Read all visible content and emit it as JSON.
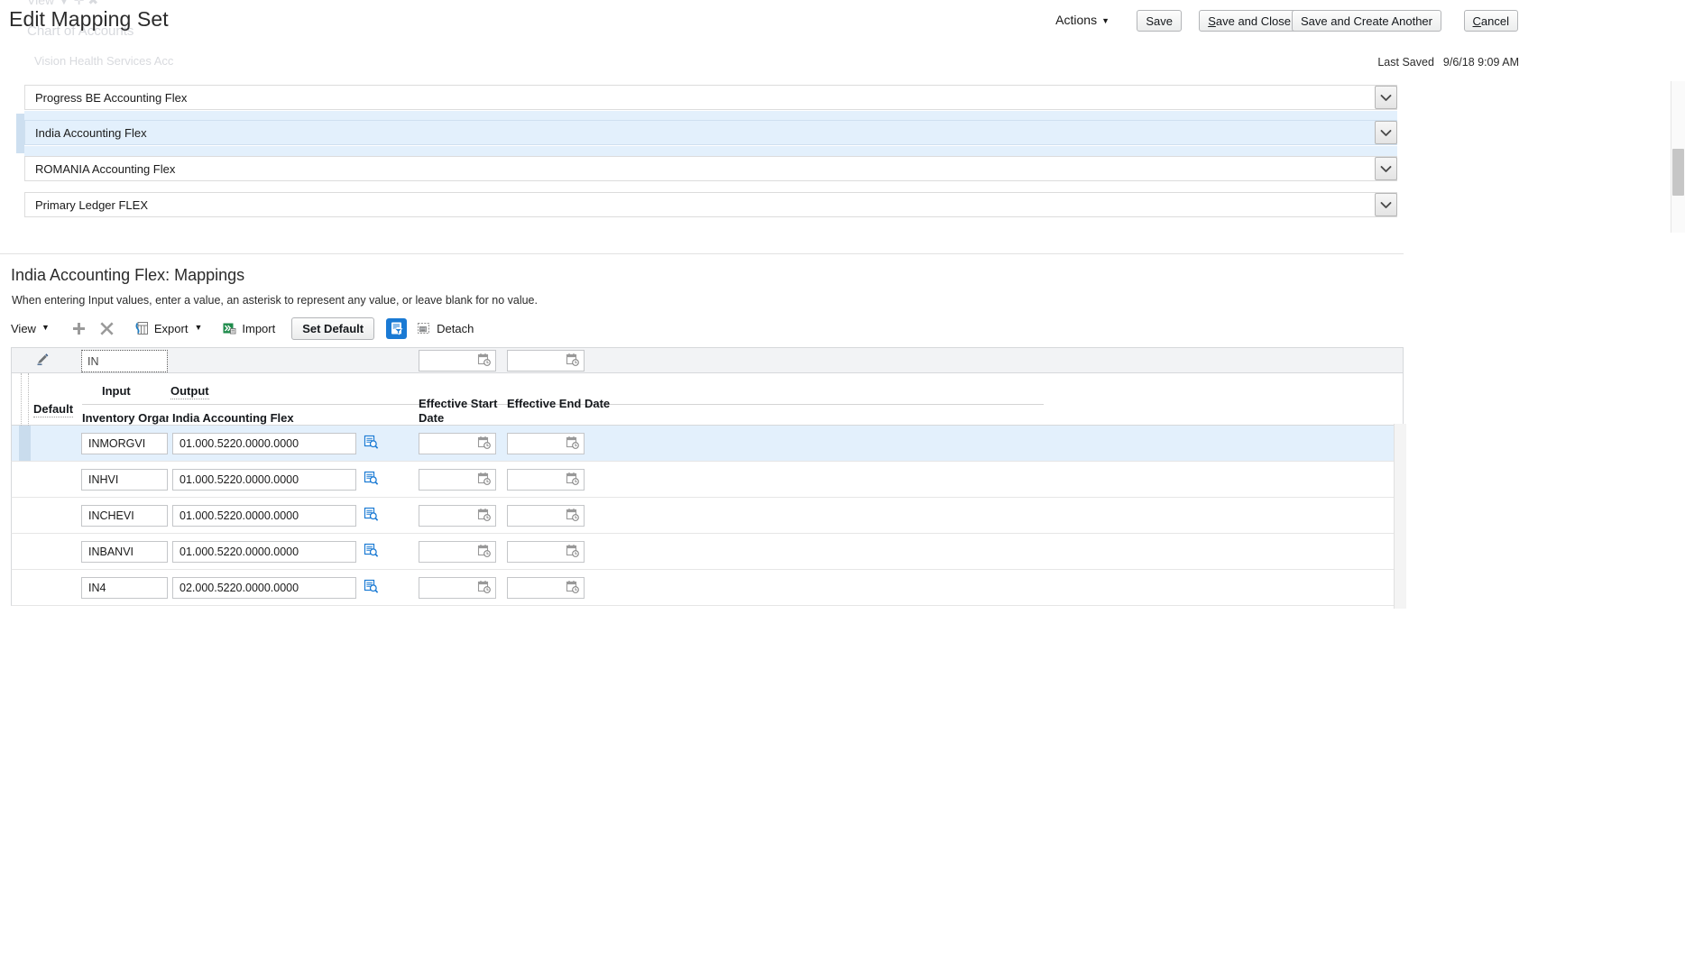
{
  "ghost": {
    "view_label": "View ▼   ✛   ✖",
    "chart_of_accounts": "Chart of Accounts",
    "account_name": "Vision Health Services Acc"
  },
  "header": {
    "page_title": "Edit Mapping Set",
    "actions_label": "Actions",
    "actions_caret": "▼",
    "buttons": {
      "save": "Save",
      "save_and_close_pre": "S",
      "save_and_close_post": "ave and Close",
      "save_and_create_another": "Save and Create Another",
      "cancel_pre": "C",
      "cancel_post": "ancel"
    },
    "last_saved_label": "Last Saved",
    "last_saved_value": "9/6/18 9:09 AM"
  },
  "flex_list": {
    "items": [
      {
        "label": "Progress BE Accounting Flex",
        "selected": false
      },
      {
        "label": "India Accounting Flex",
        "selected": true
      },
      {
        "label": "ROMANIA Accounting Flex",
        "selected": false
      },
      {
        "label": "Primary Ledger FLEX",
        "selected": false
      }
    ],
    "expand_icon": "chevron-down-icon"
  },
  "mappings": {
    "section_title": "India Accounting Flex: Mappings",
    "hint": "When entering Input values, enter a value, an asterisk to represent any value, or leave blank for no value.",
    "toolbar": {
      "view_label": "View",
      "view_caret": "▼",
      "add_icon": "plus-icon",
      "delete_icon": "cross-icon",
      "export_label": "Export",
      "export_caret": "▼",
      "export_icon": "export-icon",
      "import_label": "Import",
      "import_icon": "import-icon",
      "set_default_label": "Set Default",
      "query_by_example_icon": "query-by-example-icon",
      "detach_label": "Detach",
      "detach_icon": "detach-icon"
    },
    "filter_row": {
      "edit_icon": "pencil-icon",
      "input_filter_value": "IN",
      "start_date_filter_value": "",
      "end_date_filter_value": "",
      "calendar_icon": "calendar-icon"
    },
    "columns": {
      "default": "Default",
      "input_group": "Input",
      "output_group": "Output",
      "input_sub": "Inventory Organ",
      "output_sub": "India Accounting Flex",
      "effective_start": "Effective Start Date",
      "effective_end": "Effective End Date"
    },
    "rows": [
      {
        "input": "INMORGVI",
        "output": "01.000.5220.0000.0000",
        "start_date": "",
        "end_date": "",
        "selected": true
      },
      {
        "input": "INHVI",
        "output": "01.000.5220.0000.0000",
        "start_date": "",
        "end_date": "",
        "selected": false
      },
      {
        "input": "INCHEVI",
        "output": "01.000.5220.0000.0000",
        "start_date": "",
        "end_date": "",
        "selected": false
      },
      {
        "input": "INBANVI",
        "output": "01.000.5220.0000.0000",
        "start_date": "",
        "end_date": "",
        "selected": false
      },
      {
        "input": "IN4",
        "output": "02.000.5220.0000.0000",
        "start_date": "",
        "end_date": "",
        "selected": false
      }
    ],
    "row_lov_icon": "search-lov-icon"
  },
  "colors": {
    "accent_blue": "#1a7ad4",
    "selection_blue": "#e3f0fc",
    "border_gray": "#d6d8db"
  }
}
